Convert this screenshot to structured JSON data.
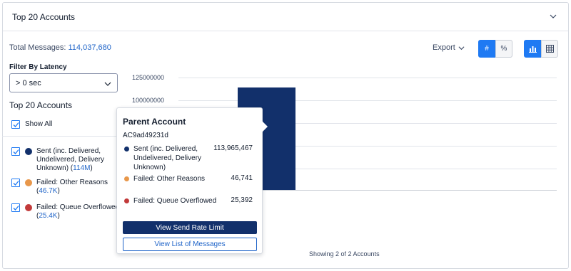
{
  "panel": {
    "title": "Top 20 Accounts"
  },
  "summary": {
    "total_label": "Total Messages:",
    "total_value": "114,037,680"
  },
  "toolbar": {
    "export_label": "Export",
    "count_toggle": "#",
    "percent_toggle": "%",
    "active_unit": "#",
    "active_view": "bar-chart"
  },
  "filter": {
    "label": "Filter By Latency",
    "value": "> 0 sec"
  },
  "accounts": {
    "title": "Top 20 Accounts",
    "show_all_label": "Show All"
  },
  "legend": [
    {
      "label": "Sent (inc. Delivered, Undelivered, Delivery Unknown)",
      "count": "114M",
      "color": "#12306b",
      "checked": true
    },
    {
      "label": "Failed: Other Reasons",
      "count": "46.7K",
      "color": "#e8974a",
      "checked": true
    },
    {
      "label": "Failed: Queue Overflowed",
      "count": "25.4K",
      "color": "#c23a3a",
      "checked": true
    }
  ],
  "chart": {
    "y_ticks": [
      "125000000",
      "100000000"
    ],
    "x_label_fragment": "m"
  },
  "chart_data": {
    "type": "bar",
    "categories": [
      "AC9ad49231d"
    ],
    "series": [
      {
        "name": "Sent (inc. Delivered, Undelivered, Delivery Unknown)",
        "values": [
          113965467
        ]
      },
      {
        "name": "Failed: Other Reasons",
        "values": [
          46741
        ]
      },
      {
        "name": "Failed: Queue Overflowed",
        "values": [
          25392
        ]
      }
    ],
    "ylim": [
      0,
      125000000
    ],
    "title": "",
    "xlabel": "",
    "ylabel": ""
  },
  "tooltip": {
    "title": "Parent Account",
    "account_id": "AC9ad49231d",
    "rows": [
      {
        "label": "Sent (inc. Delivered, Undelivered, Delivery Unknown)",
        "value": "113,965,467",
        "color": "#12306b"
      },
      {
        "label": "Failed: Other Reasons",
        "value": "46,741",
        "color": "#e8974a"
      },
      {
        "label": "Failed: Queue Overflowed",
        "value": "25,392",
        "color": "#c23a3a"
      }
    ],
    "primary_button": "View Send Rate Limit",
    "secondary_button": "View List of Messages"
  },
  "footer": {
    "status": "Showing 2 of 2 Accounts"
  }
}
